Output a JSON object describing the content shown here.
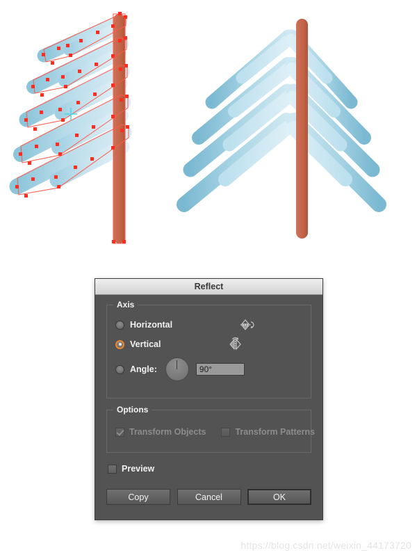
{
  "artwork": {
    "description": "Adobe Illustrator artboard with two stylised christmas trees",
    "left_tree_label": "half-tree-with-selection-anchors",
    "right_tree_label": "mirrored-complete-tree",
    "colors": {
      "trunk": "#c4654a",
      "trunk_shade": "#b65a42",
      "branch_light": "#d4e8f2",
      "branch_mid": "#a8d4e6",
      "branch_dark": "#74b6cf",
      "selection": "#ff2d20",
      "anchor": "#ff2d20",
      "background": "#ffffff"
    }
  },
  "watermark": {
    "text": "https://blog.csdn.net/weixin_44173720"
  },
  "dialog": {
    "title": "Reflect",
    "axis": {
      "group_label": "Axis",
      "options": [
        {
          "label": "Horizontal",
          "selected": false,
          "icon": "reflect-horizontal-icon"
        },
        {
          "label": "Vertical",
          "selected": true,
          "icon": "reflect-vertical-icon"
        }
      ],
      "angle": {
        "label": "Angle:",
        "selected": false,
        "value": "90°",
        "dial_degrees": 90
      }
    },
    "options": {
      "group_label": "Options",
      "items": [
        {
          "label": "Transform Objects",
          "checked": true,
          "disabled": true
        },
        {
          "label": "Transform Patterns",
          "checked": false,
          "disabled": true
        }
      ]
    },
    "preview": {
      "label": "Preview",
      "checked": false
    },
    "buttons": [
      {
        "label": "Copy",
        "default": false
      },
      {
        "label": "Cancel",
        "default": false
      },
      {
        "label": "OK",
        "default": true
      }
    ],
    "colors": {
      "background": "#535353",
      "titlebar": "#e2e2e2",
      "accent": "#e8872a",
      "text": "#f0f0f0"
    }
  }
}
